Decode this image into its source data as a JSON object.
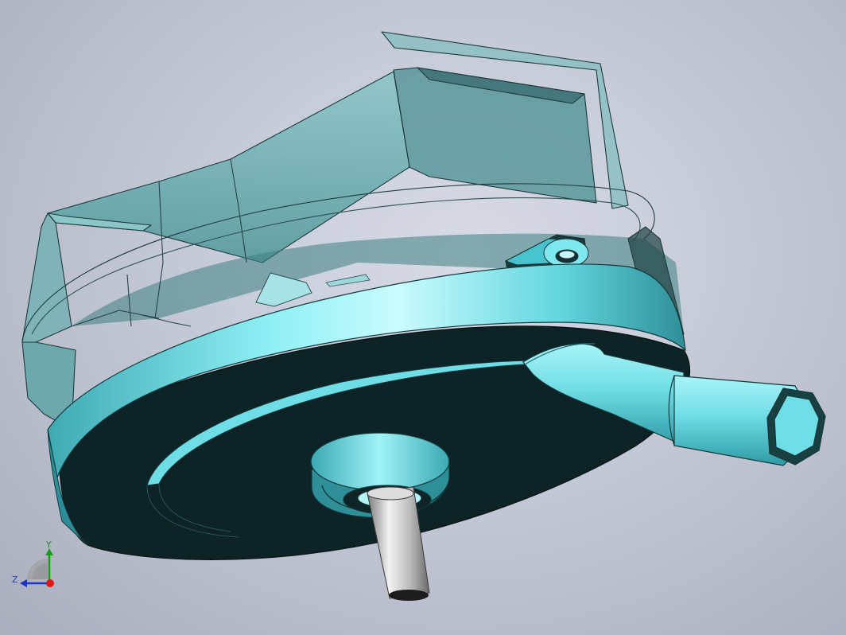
{
  "scene": {
    "background": "#c6cad8",
    "part_color": "#5fd3dd",
    "part_dark": "#0f2426",
    "glass_color": "#6ab6b8",
    "shaft_color": "#c4c4c4"
  },
  "triad": {
    "y_label": "Y",
    "z_label": "Z",
    "x_color": "#e01818",
    "y_color": "#1d9a1d",
    "z_color": "#1f35c8"
  }
}
